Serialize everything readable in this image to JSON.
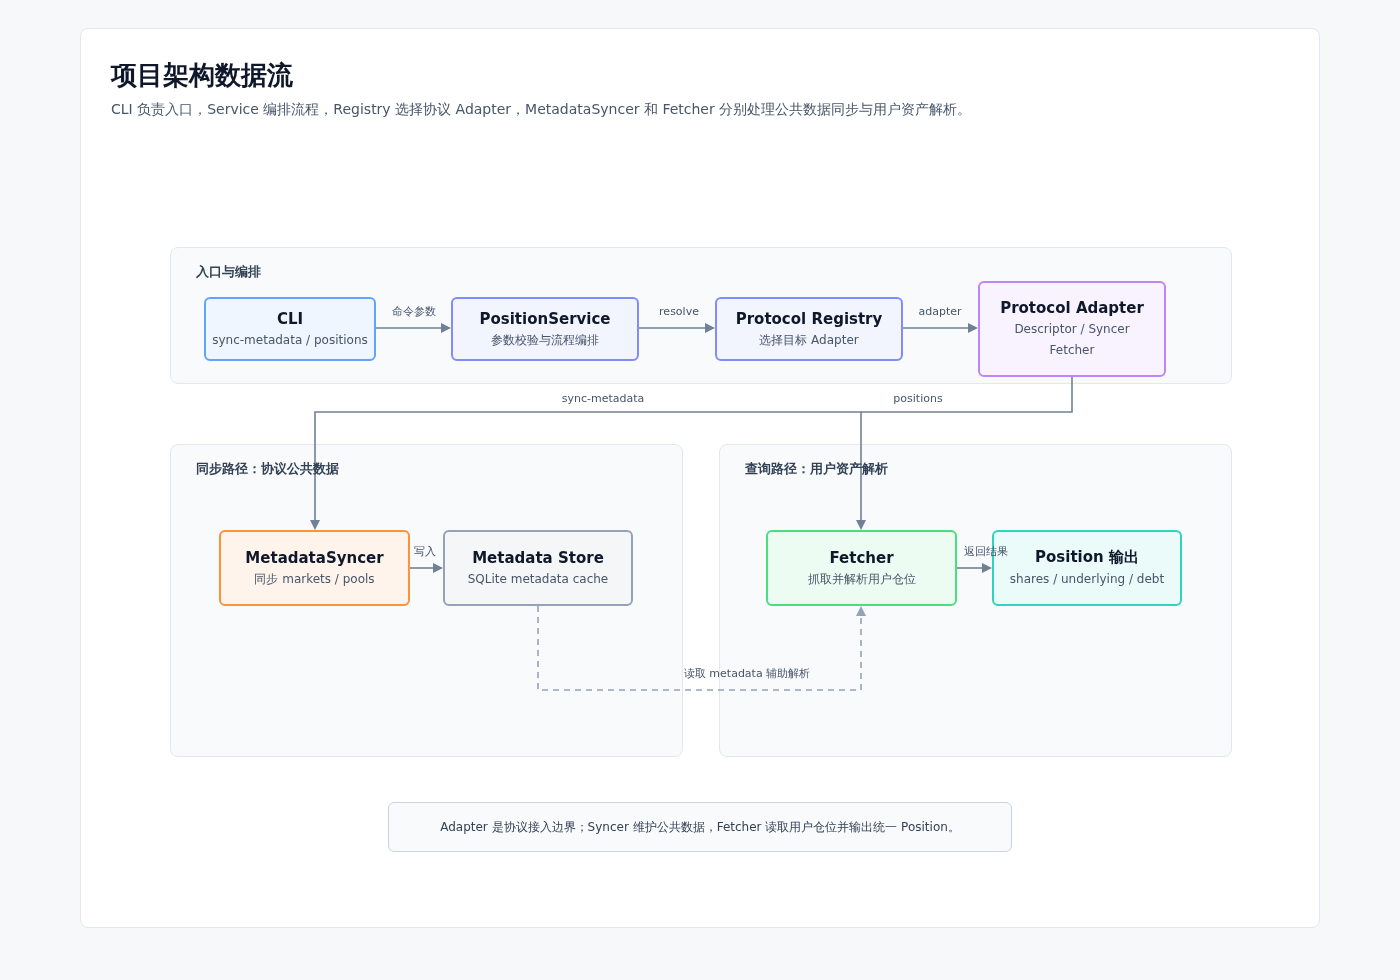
{
  "title": "项目架构数据流",
  "subtitle": "CLI 负责入口，Service 编排流程，Registry 选择协议 Adapter，MetadataSyncer 和 Fetcher 分别处理公共数据同步与用户资产解析。",
  "groups": [
    {
      "label": "入口与编排"
    },
    {
      "label": "同步路径：协议公共数据"
    },
    {
      "label": "查询路径：用户资产解析"
    }
  ],
  "nodes": [
    {
      "title": "CLI",
      "lines": [
        "sync-metadata / positions"
      ],
      "color": "#60a5fa"
    },
    {
      "title": "PositionService",
      "lines": [
        "参数校验与流程编排"
      ],
      "color": "#818cf8"
    },
    {
      "title": "Protocol Registry",
      "lines": [
        "选择目标 Adapter"
      ],
      "color": "#818cf8"
    },
    {
      "title": "Protocol Adapter",
      "lines": [
        "Descriptor / Syncer",
        "Fetcher"
      ],
      "color": "#c084fc"
    },
    {
      "title": "MetadataSyncer",
      "lines": [
        "同步 markets / pools"
      ],
      "color": "#fb923c"
    },
    {
      "title": "Metadata Store",
      "lines": [
        "SQLite metadata cache"
      ],
      "color": "#94a3b8"
    },
    {
      "title": "Fetcher",
      "lines": [
        "抓取并解析用户仓位"
      ],
      "color": "#4ade80"
    },
    {
      "title": "Position 输出",
      "lines": [
        "shares / underlying / debt"
      ],
      "color": "#2dd4bf"
    }
  ],
  "edges": [
    {
      "label": "命令参数",
      "kind": "solid"
    },
    {
      "label": "resolve",
      "kind": "solid"
    },
    {
      "label": "adapter",
      "kind": "solid"
    },
    {
      "label": "sync-metadata",
      "kind": "solid"
    },
    {
      "label": "positions",
      "kind": "solid"
    },
    {
      "label": "写入",
      "kind": "solid"
    },
    {
      "label": "返回结果",
      "kind": "solid"
    },
    {
      "label": "读取 metadata 辅助解析",
      "kind": "dashed"
    }
  ],
  "note": "Adapter 是协议接入边界；Syncer 维护公共数据，Fetcher 读取用户仓位并输出统一 Position。"
}
